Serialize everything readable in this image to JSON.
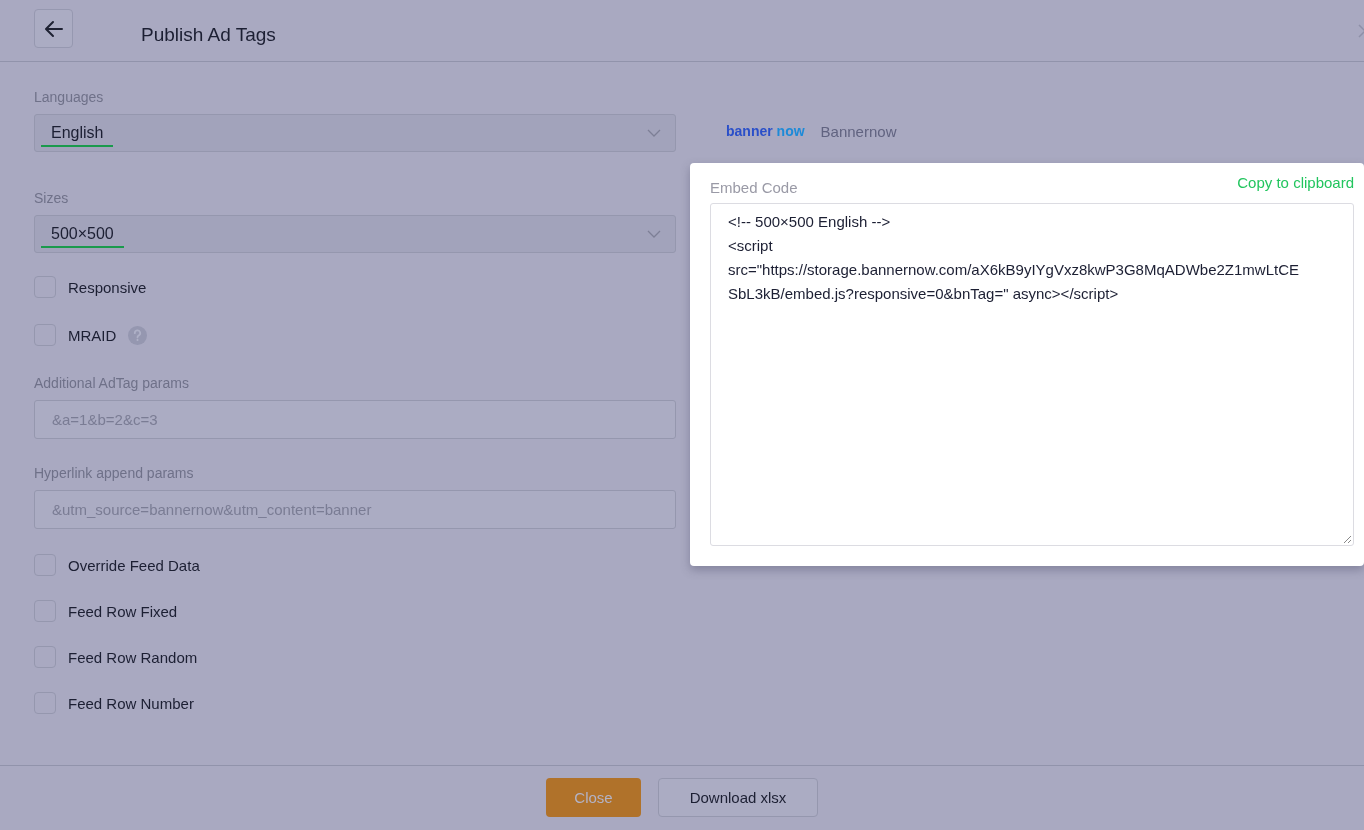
{
  "header": {
    "title": "Publish Ad Tags"
  },
  "form": {
    "languages": {
      "label": "Languages",
      "value": "English"
    },
    "sizes": {
      "label": "Sizes",
      "value": "500×500"
    },
    "options_top": [
      {
        "label": "Responsive",
        "checked": false,
        "help": false
      },
      {
        "label": "MRAID",
        "checked": false,
        "help": true
      }
    ],
    "adtag_params": {
      "label": "Additional AdTag params",
      "placeholder": "&a=1&b=2&c=3"
    },
    "hyperlink_params": {
      "label": "Hyperlink append params",
      "placeholder": "&utm_source=bannernow&utm_content=banner"
    },
    "options_bottom": [
      {
        "label": "Override Feed Data",
        "checked": false
      },
      {
        "label": "Feed Row Fixed",
        "checked": false
      },
      {
        "label": "Feed Row Random",
        "checked": false
      },
      {
        "label": "Feed Row Number",
        "checked": false
      }
    ]
  },
  "brand": {
    "logo_left": "banner",
    "logo_right": "now",
    "name": "Bannernow"
  },
  "embed": {
    "label": "Embed Code",
    "copy_link": "Copy to clipboard",
    "code_lines": [
      "<!-- 500×500 English -->",
      "<script",
      "src=\"https://storage.bannernow.com/aX6kB9yIYgVxz8kwP3G8MqADWbe2Z1mwLtCE",
      "SbL3kB/embed.js?responsive=0&bnTag=\" async></script>"
    ]
  },
  "footer": {
    "buttons": [
      {
        "label": "Close",
        "kind": "primary"
      },
      {
        "label": "Download xlsx",
        "kind": "secondary"
      }
    ]
  }
}
